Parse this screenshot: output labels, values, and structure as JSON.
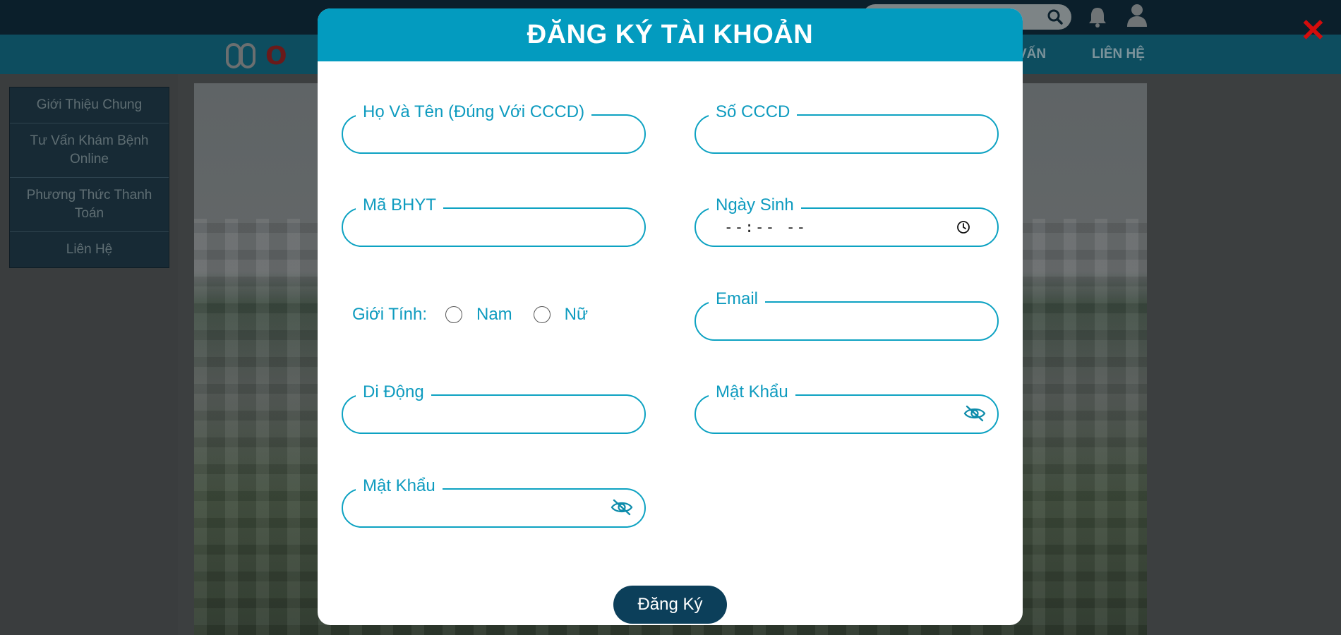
{
  "page": {
    "nav_links": [
      "VẤN",
      "LIÊN HỆ"
    ],
    "logo_text": "O",
    "sidebar_items": [
      "Giới Thiệu Chung",
      "Tư Vấn Khám Bệnh Online",
      "Phương Thức Thanh Toán",
      "Liên Hệ"
    ]
  },
  "modal": {
    "title": "ĐĂNG KÝ TÀI KHOẢN",
    "fields": {
      "full_name": {
        "label": "Họ Và Tên (Đúng Với CCCD)",
        "value": ""
      },
      "cccd": {
        "label": "Số CCCD",
        "value": ""
      },
      "bhyt": {
        "label": "Mã BHYT",
        "value": ""
      },
      "birthdate": {
        "label": "Ngày Sinh",
        "placeholder": "--:-- --"
      },
      "email": {
        "label": "Email",
        "value": ""
      },
      "mobile": {
        "label": "Di Động",
        "value": ""
      },
      "password": {
        "label": "Mật Khẩu",
        "value": ""
      },
      "confirm_password": {
        "label": "Mật Khẩu",
        "value": ""
      }
    },
    "gender": {
      "label": "Giới Tính:",
      "options": [
        "Nam",
        "Nữ"
      ],
      "selected": null
    },
    "submit_label": "Đăng Ký"
  },
  "colors": {
    "accent": "#039bbf",
    "field_border": "#0da2c2",
    "submit_bg": "#0c3f5a",
    "close": "#d40c0c"
  },
  "icons": [
    "search-icon",
    "bell-icon",
    "user-icon",
    "close-icon",
    "eye-slash-icon",
    "clock-icon"
  ]
}
